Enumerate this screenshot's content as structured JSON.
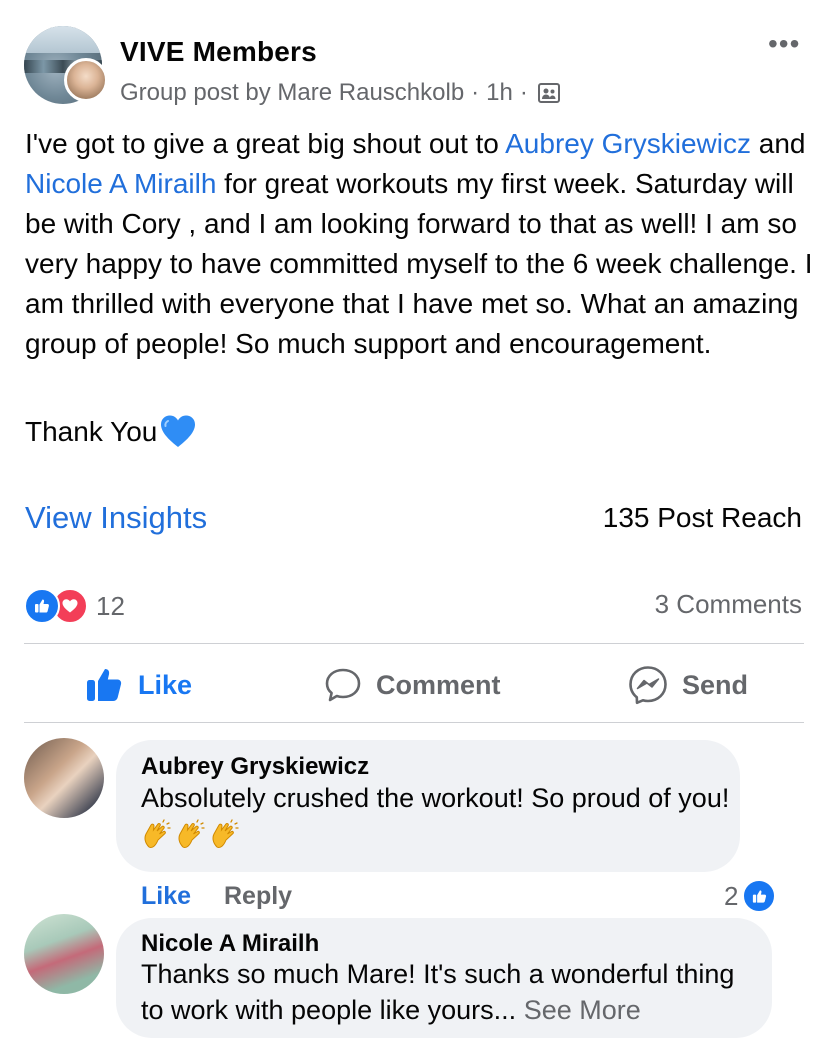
{
  "post": {
    "group_name": "VIVE Members",
    "byline": "Group post by Mare Rauschkolb",
    "time": "1h",
    "separator": "·",
    "privacy_icon": "members-group-icon",
    "more_label": "•••",
    "text": {
      "p1": "I've got to give a great big shout out to ",
      "mention1": "Aubrey Gryskiewicz",
      "p2": " and ",
      "mention2": "Nicole A Mirailh",
      "p3": " for great workouts my first week. Saturday will be with Cory , and I am looking forward to that as well! I am so very happy to have committed myself to the 6 week challenge. I am thrilled with everyone that I have met so. What an amazing group of people! So much support and encouragement.",
      "thanks": "Thank You",
      "thanks_emoji": "blue-heart"
    }
  },
  "insights": {
    "link_label": "View Insights",
    "reach": "135 Post Reach"
  },
  "reactions": {
    "icons": [
      "like",
      "love"
    ],
    "count": "12",
    "comments": "3 Comments"
  },
  "actions": {
    "like": "Like",
    "comment": "Comment",
    "send": "Send"
  },
  "comments": [
    {
      "author": "Aubrey Gryskiewicz",
      "text": "Absolutely crushed the workout! So proud of you!",
      "emoji": "clapping-hands x3",
      "like_label": "Like",
      "reply_label": "Reply",
      "reaction_count": "2"
    },
    {
      "author": "Nicole A Mirailh",
      "text": "Thanks so much Mare! It's such a wonderful thing to work with people like yours...",
      "see_more": "See More"
    }
  ],
  "colors": {
    "link": "#216fdb",
    "like_blue": "#1877f2",
    "love_red": "#f33e58",
    "secondary_text": "#65676b",
    "bubble_bg": "#f0f2f5",
    "divider": "#ced0d4"
  }
}
